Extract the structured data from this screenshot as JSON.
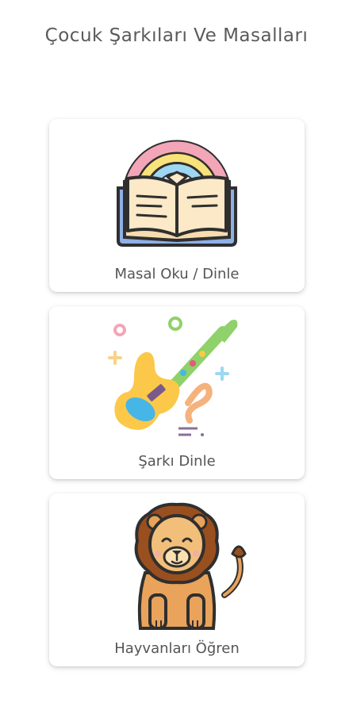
{
  "header": {
    "title": "Çocuk Şarkıları Ve Masalları"
  },
  "menu": {
    "items": [
      {
        "label": "Masal Oku / Dinle",
        "icon": "rainbow-book-icon"
      },
      {
        "label": "Şarkı Dinle",
        "icon": "guitar-icon"
      },
      {
        "label": "Hayvanları Öğren",
        "icon": "lion-icon"
      }
    ]
  },
  "colors": {
    "background": "#ffffff",
    "text": "#555555",
    "outline": "#2f2f2f",
    "rainbow_pink": "#f3a6b8",
    "rainbow_yellow": "#f8e27a",
    "rainbow_blue": "#9dd7f2",
    "book_page": "#fbe9c7",
    "book_cover": "#8fb0e6",
    "guitar_body": "#fbc84a",
    "guitar_neck": "#8fd16a",
    "guitar_hole": "#46b6e6",
    "guitar_accent": "#f5b27c",
    "lion_mane": "#9a4f1e",
    "lion_body": "#e9a35a",
    "lion_face": "#f2bf7a"
  }
}
